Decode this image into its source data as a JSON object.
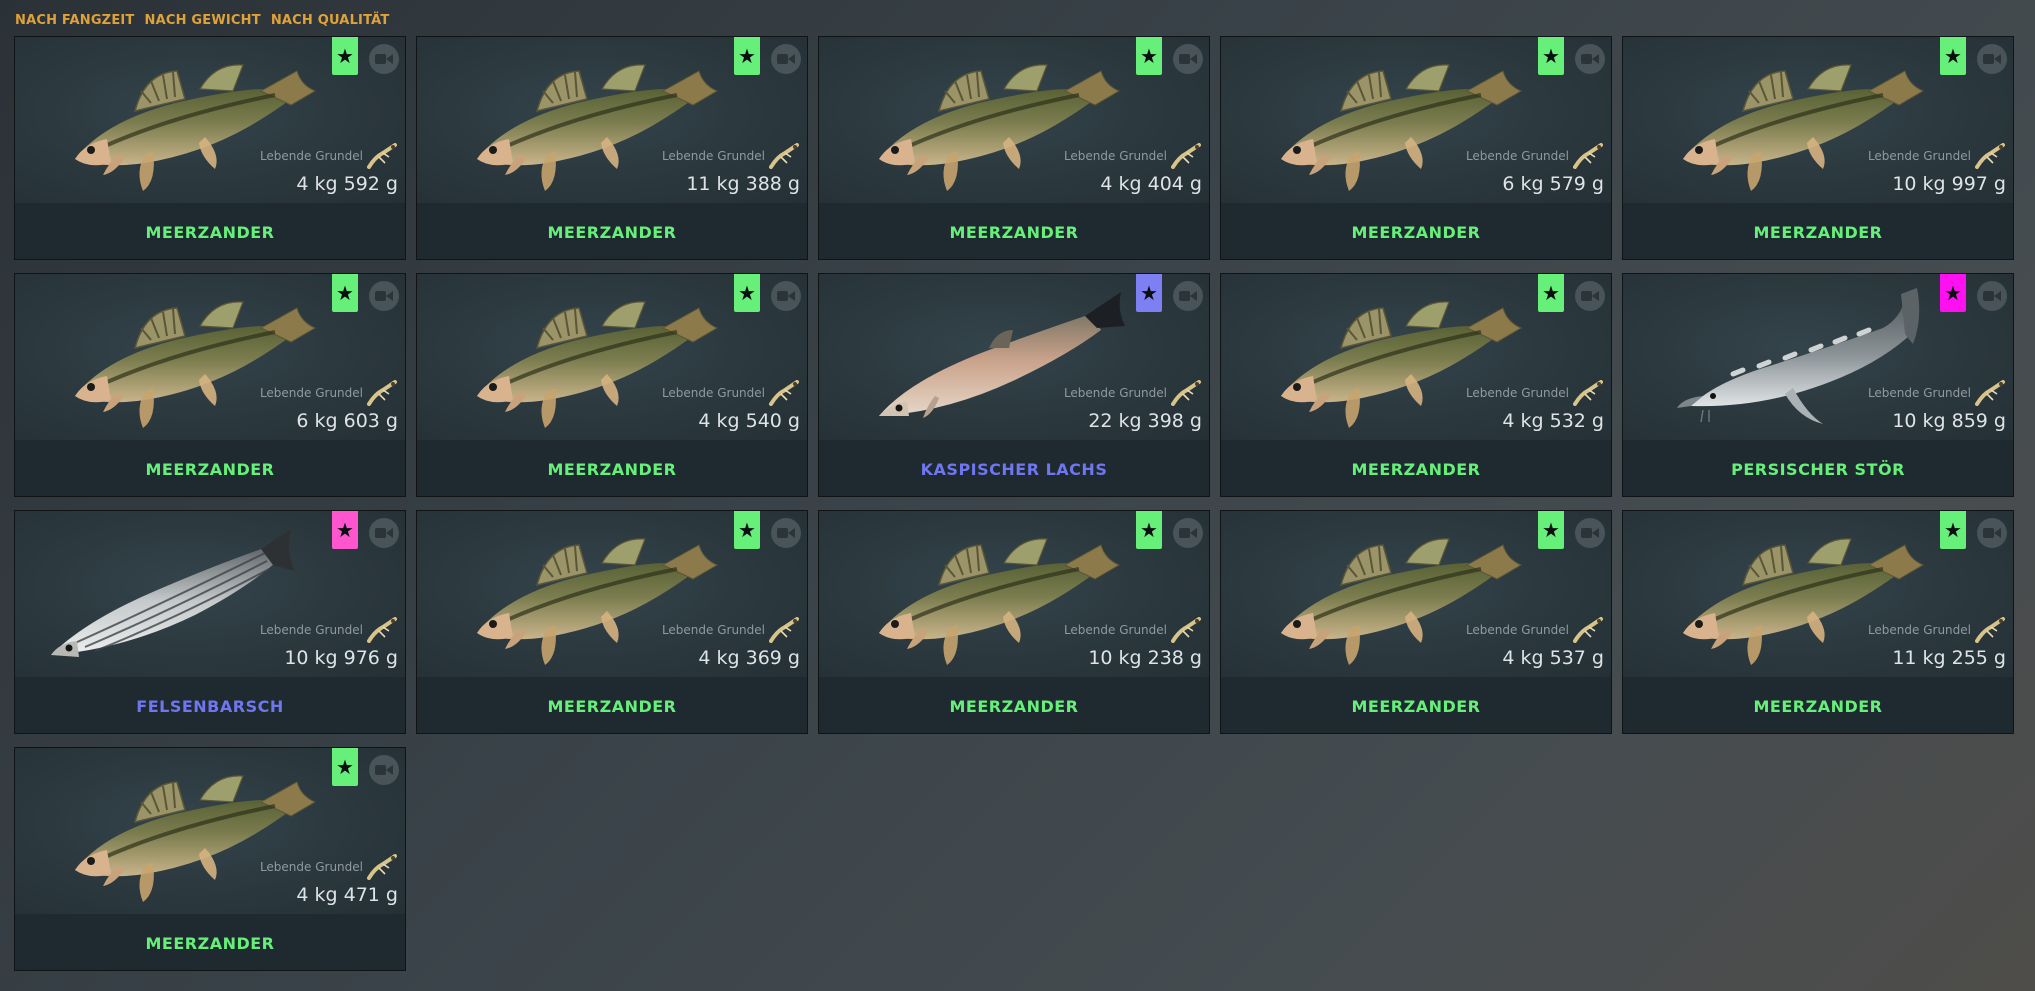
{
  "sort": {
    "by_time": "NACH FANGZEIT",
    "by_weight": "NACH GEWICHT",
    "by_quality": "NACH QUALITÄT"
  },
  "colors": {
    "green": "#66f07a",
    "blue": "#6f76f0",
    "purple": "#7e7ff2",
    "pink": "#ff55cf",
    "magenta": "#ff10f0",
    "accent": "#e0a238"
  },
  "cards": [
    {
      "name": "MEERZANDER",
      "name_color": "#66f07a",
      "badge_color": "#66f07a",
      "fish": "zander",
      "bait": "Lebende Grundel",
      "weight": "4 kg 592 g"
    },
    {
      "name": "MEERZANDER",
      "name_color": "#66f07a",
      "badge_color": "#66f07a",
      "fish": "zander",
      "bait": "Lebende Grundel",
      "weight": "11 kg 388 g"
    },
    {
      "name": "MEERZANDER",
      "name_color": "#66f07a",
      "badge_color": "#66f07a",
      "fish": "zander",
      "bait": "Lebende Grundel",
      "weight": "4 kg 404 g"
    },
    {
      "name": "MEERZANDER",
      "name_color": "#66f07a",
      "badge_color": "#66f07a",
      "fish": "zander",
      "bait": "Lebende Grundel",
      "weight": "6 kg 579 g"
    },
    {
      "name": "MEERZANDER",
      "name_color": "#66f07a",
      "badge_color": "#66f07a",
      "fish": "zander",
      "bait": "Lebende Grundel",
      "weight": "10 kg 997 g"
    },
    {
      "name": "MEERZANDER",
      "name_color": "#66f07a",
      "badge_color": "#66f07a",
      "fish": "zander",
      "bait": "Lebende Grundel",
      "weight": "6 kg 603 g"
    },
    {
      "name": "MEERZANDER",
      "name_color": "#66f07a",
      "badge_color": "#66f07a",
      "fish": "zander",
      "bait": "Lebende Grundel",
      "weight": "4 kg 540 g"
    },
    {
      "name": "KASPISCHER LACHS",
      "name_color": "#6f76f0",
      "badge_color": "#7e7ff2",
      "fish": "salmon",
      "bait": "Lebende Grundel",
      "weight": "22 kg 398 g"
    },
    {
      "name": "MEERZANDER",
      "name_color": "#66f07a",
      "badge_color": "#66f07a",
      "fish": "zander",
      "bait": "Lebende Grundel",
      "weight": "4 kg 532 g"
    },
    {
      "name": "PERSISCHER STÖR",
      "name_color": "#66f07a",
      "badge_color": "#ff10f0",
      "fish": "sturgeon",
      "bait": "Lebende Grundel",
      "weight": "10 kg 859 g"
    },
    {
      "name": "FELSENBARSCH",
      "name_color": "#6f76f0",
      "badge_color": "#ff55cf",
      "fish": "bass",
      "bait": "Lebende Grundel",
      "weight": "10 kg 976 g"
    },
    {
      "name": "MEERZANDER",
      "name_color": "#66f07a",
      "badge_color": "#66f07a",
      "fish": "zander",
      "bait": "Lebende Grundel",
      "weight": "4 kg 369 g"
    },
    {
      "name": "MEERZANDER",
      "name_color": "#66f07a",
      "badge_color": "#66f07a",
      "fish": "zander",
      "bait": "Lebende Grundel",
      "weight": "10 kg 238 g"
    },
    {
      "name": "MEERZANDER",
      "name_color": "#66f07a",
      "badge_color": "#66f07a",
      "fish": "zander",
      "bait": "Lebende Grundel",
      "weight": "4 kg 537 g"
    },
    {
      "name": "MEERZANDER",
      "name_color": "#66f07a",
      "badge_color": "#66f07a",
      "fish": "zander",
      "bait": "Lebende Grundel",
      "weight": "11 kg 255 g"
    },
    {
      "name": "MEERZANDER",
      "name_color": "#66f07a",
      "badge_color": "#66f07a",
      "fish": "zander",
      "bait": "Lebende Grundel",
      "weight": "4 kg 471 g"
    }
  ]
}
